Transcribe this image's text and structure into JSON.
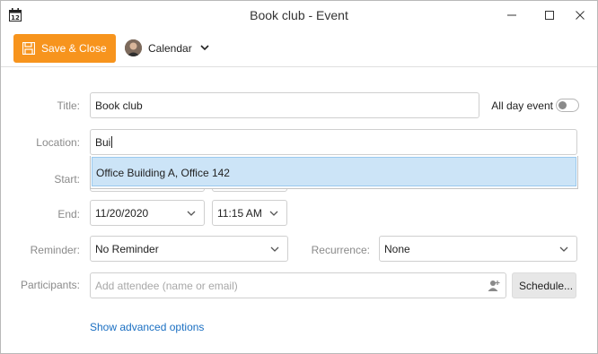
{
  "window": {
    "title": "Book club - Event",
    "app_icon": "calendar-12-icon",
    "controls": [
      "minimize-icon",
      "maximize-icon",
      "close-icon"
    ]
  },
  "toolbar": {
    "save_label": "Save & Close",
    "save_color": "#f7941d",
    "calendar_label": "Calendar"
  },
  "form": {
    "title": {
      "label": "Title:",
      "value": "Book club"
    },
    "all_day": {
      "label": "All day event",
      "checked": false
    },
    "location": {
      "label": "Location:",
      "value": "Bui"
    },
    "location_suggestion": "Office Building A, Office 142",
    "start": {
      "label": "Start:"
    },
    "end": {
      "label": "End:",
      "date": "11/20/2020",
      "time": "11:15 AM"
    },
    "reminder": {
      "label": "Reminder:",
      "value": "No Reminder"
    },
    "recurrence": {
      "label": "Recurrence:",
      "value": "None"
    },
    "participants": {
      "label": "Participants:",
      "placeholder": "Add attendee (name or email)",
      "schedule_label": "Schedule..."
    },
    "advanced_link": "Show advanced options"
  },
  "colors": {
    "accent": "#f7941d",
    "link": "#1a6fc2",
    "selection": "#cce4f7"
  }
}
